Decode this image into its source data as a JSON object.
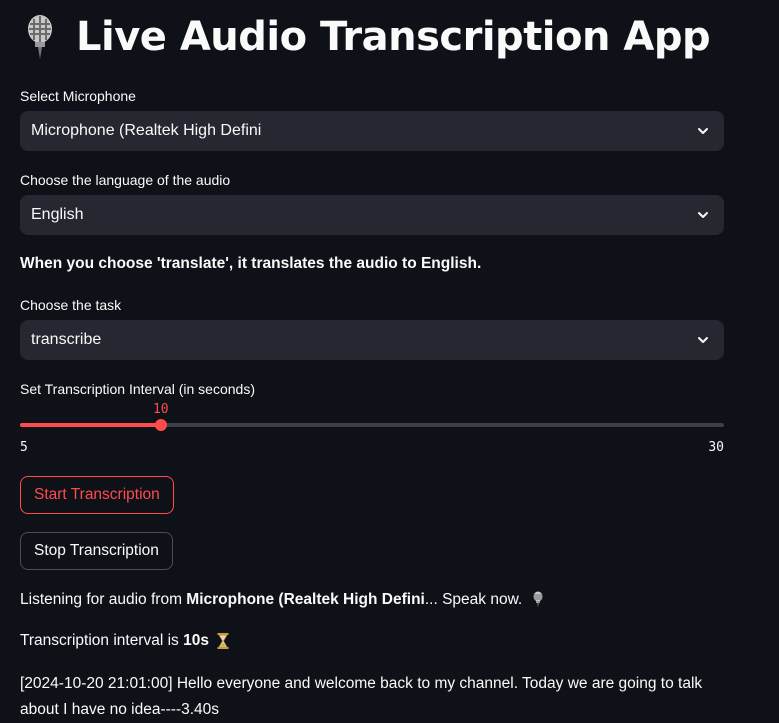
{
  "app": {
    "title": "Live Audio Transcription App"
  },
  "microphone": {
    "label": "Select Microphone",
    "value": "Microphone (Realtek High Defini"
  },
  "language": {
    "label": "Choose the language of the audio",
    "value": "English"
  },
  "translate_note": "When you choose 'translate', it translates the audio to English.",
  "task": {
    "label": "Choose the task",
    "value": "transcribe"
  },
  "interval": {
    "label": "Set Transcription Interval (in seconds)",
    "min": "5",
    "max": "30",
    "value": "10",
    "min_num": 5,
    "max_num": 30,
    "value_num": 10
  },
  "buttons": {
    "start": "Start Transcription",
    "stop": "Stop Transcription"
  },
  "status": {
    "listening_prefix": "Listening for audio from ",
    "listening_device": "Microphone (Realtek High Defini",
    "listening_suffix": "... Speak now.",
    "interval_prefix": "Transcription interval is ",
    "interval_value": "10s"
  },
  "transcript": "[2024-10-20 21:01:00] Hello everyone and welcome back to my channel. Today we are going to talk about I have no idea----3.40s",
  "colors": {
    "accent": "#ff4b4b",
    "background": "#0e1117",
    "input_bg": "#262730",
    "text": "#fafafa"
  },
  "icons": {
    "title": "microphone-icon",
    "status": "microphone-icon",
    "interval": "hourglass-icon",
    "select": "chevron-down-icon"
  }
}
